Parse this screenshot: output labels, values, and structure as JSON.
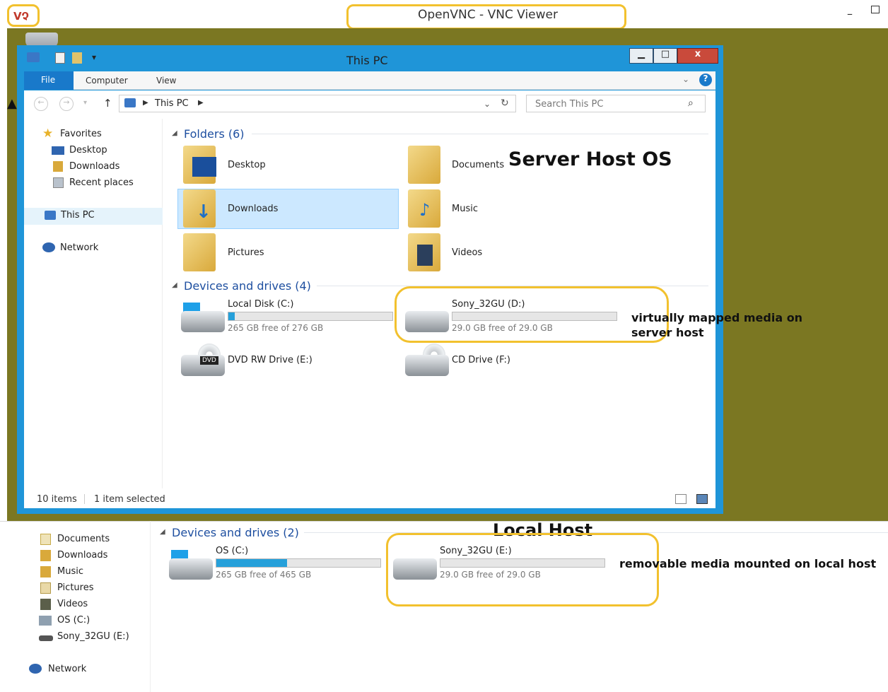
{
  "vnc": {
    "logo": "VՉ",
    "title": "OpenVNC - VNC Viewer",
    "minimize_glyph": "–"
  },
  "window": {
    "title": "This PC",
    "controls": {
      "minimize": "▁",
      "maximize": "□",
      "close": "x"
    },
    "ribbon_tabs": [
      "File",
      "Computer",
      "View"
    ],
    "address": {
      "path": [
        "This PC"
      ],
      "search_placeholder": "Search This PC"
    },
    "nav": {
      "favorites": {
        "label": "Favorites",
        "items": [
          "Desktop",
          "Downloads",
          "Recent places"
        ]
      },
      "this_pc": "This PC",
      "network": "Network"
    },
    "folders": {
      "header": "Folders (6)",
      "items": [
        "Desktop",
        "Documents",
        "Downloads",
        "Music",
        "Pictures",
        "Videos"
      ]
    },
    "drives": {
      "header": "Devices and drives (4)",
      "items": [
        {
          "name": "Local Disk (C:)",
          "free": "265 GB free of 276 GB",
          "used_fraction": 0.04
        },
        {
          "name": "Sony_32GU (D:)",
          "free": "29.0 GB free of 29.0 GB",
          "used_fraction": 0.0
        },
        {
          "name": "DVD RW Drive (E:)",
          "dvd_label": "DVD"
        },
        {
          "name": "CD Drive (F:)"
        }
      ]
    },
    "status": {
      "count": "10 items",
      "selection": "1 item selected"
    }
  },
  "annotations": {
    "server": "Server Host OS",
    "mapped": "virtually mapped media on server host",
    "local": "Local Host",
    "removable": "removable media mounted on local host"
  },
  "local": {
    "nav": [
      "Documents",
      "Downloads",
      "Music",
      "Pictures",
      "Videos",
      "OS (C:)",
      "Sony_32GU (E:)"
    ],
    "network": "Network",
    "drives_header": "Devices and drives (2)",
    "drives": [
      {
        "name": "OS (C:)",
        "free": "265 GB free of 465 GB",
        "used_fraction": 0.43
      },
      {
        "name": "Sony_32GU (E:)",
        "free": "29.0 GB free of 29.0 GB",
        "used_fraction": 0.0
      }
    ]
  },
  "colors": {
    "desktop": "#7b7722",
    "accent": "#1f95d8",
    "highlight": "#f2c12e",
    "bar_fill": "#26a0da"
  }
}
